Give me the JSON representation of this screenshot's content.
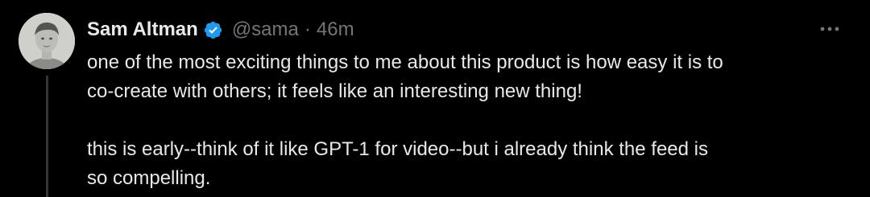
{
  "author": {
    "name": "Sam Altman",
    "handle": "@sama",
    "separator": "·",
    "time": "46m",
    "verified_color": "#1d9bf0"
  },
  "tweet": {
    "paragraph1_line1": "one of the most exciting things to me about this product is how easy it is to",
    "paragraph1_line2": "co-create with others; it feels like an interesting new thing!",
    "paragraph2_line1": "this is early--think of it like GPT-1 for video--but i already think the feed is",
    "paragraph2_line2": "so compelling."
  },
  "icons": {
    "verified": "verified-badge-icon",
    "more": "more-horizontal-icon",
    "avatar": "avatar"
  },
  "colors": {
    "background": "#000000",
    "text": "#e7e9ea",
    "secondary": "#71767b",
    "thread_line": "#333639"
  }
}
